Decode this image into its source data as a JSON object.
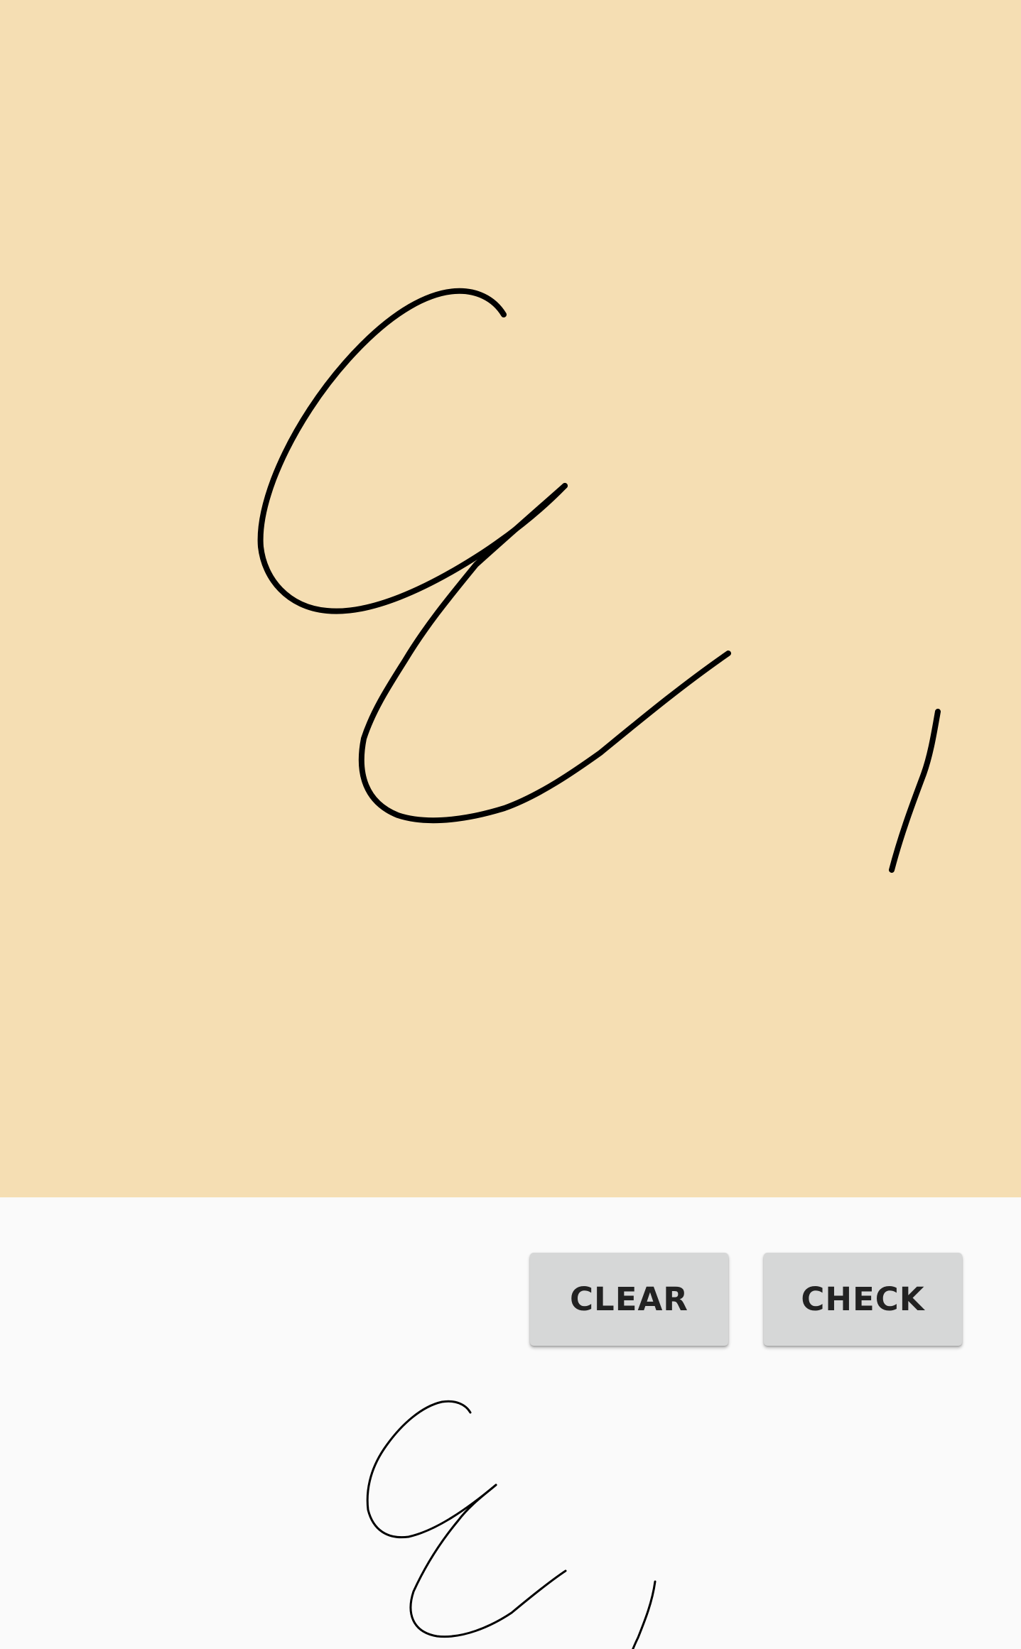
{
  "drawing_canvas": {
    "background": "#f5deb3",
    "stroke_color": "#000000"
  },
  "buttons": {
    "clear_label": "CLEAR",
    "check_label": "CHECK"
  },
  "preview": {
    "stroke_color": "#000000"
  }
}
